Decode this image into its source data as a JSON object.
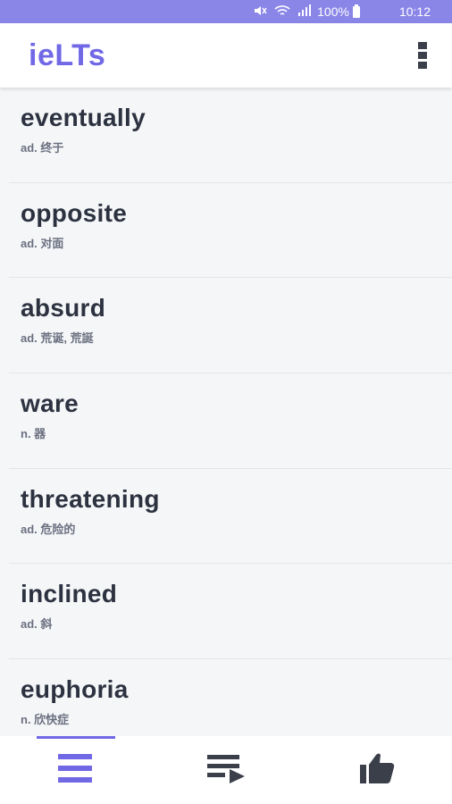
{
  "status_bar": {
    "battery_percent": "100%",
    "time": "10:12"
  },
  "app_bar": {
    "title": "ieLTs",
    "menu_icon": "more-vertical-icon"
  },
  "words": [
    {
      "term": "eventually",
      "definition": "ad. 终于"
    },
    {
      "term": "opposite",
      "definition": "ad. 对面"
    },
    {
      "term": "absurd",
      "definition": "ad. 荒诞, 荒誕"
    },
    {
      "term": "ware",
      "definition": "n. 器"
    },
    {
      "term": "threatening",
      "definition": "ad. 危险的"
    },
    {
      "term": "inclined",
      "definition": "ad. 斜"
    },
    {
      "term": "euphoria",
      "definition": "n. 欣快症"
    }
  ],
  "bottom_nav": {
    "tabs": [
      {
        "icon": "list-icon",
        "active": true
      },
      {
        "icon": "playlist-play-icon",
        "active": false
      },
      {
        "icon": "thumbs-up-icon",
        "active": false
      }
    ]
  },
  "colors": {
    "accent": "#7168e6",
    "status_bar": "#8a86e8",
    "text_dark": "#2c3240",
    "icon_dark": "#3a3f4a"
  }
}
